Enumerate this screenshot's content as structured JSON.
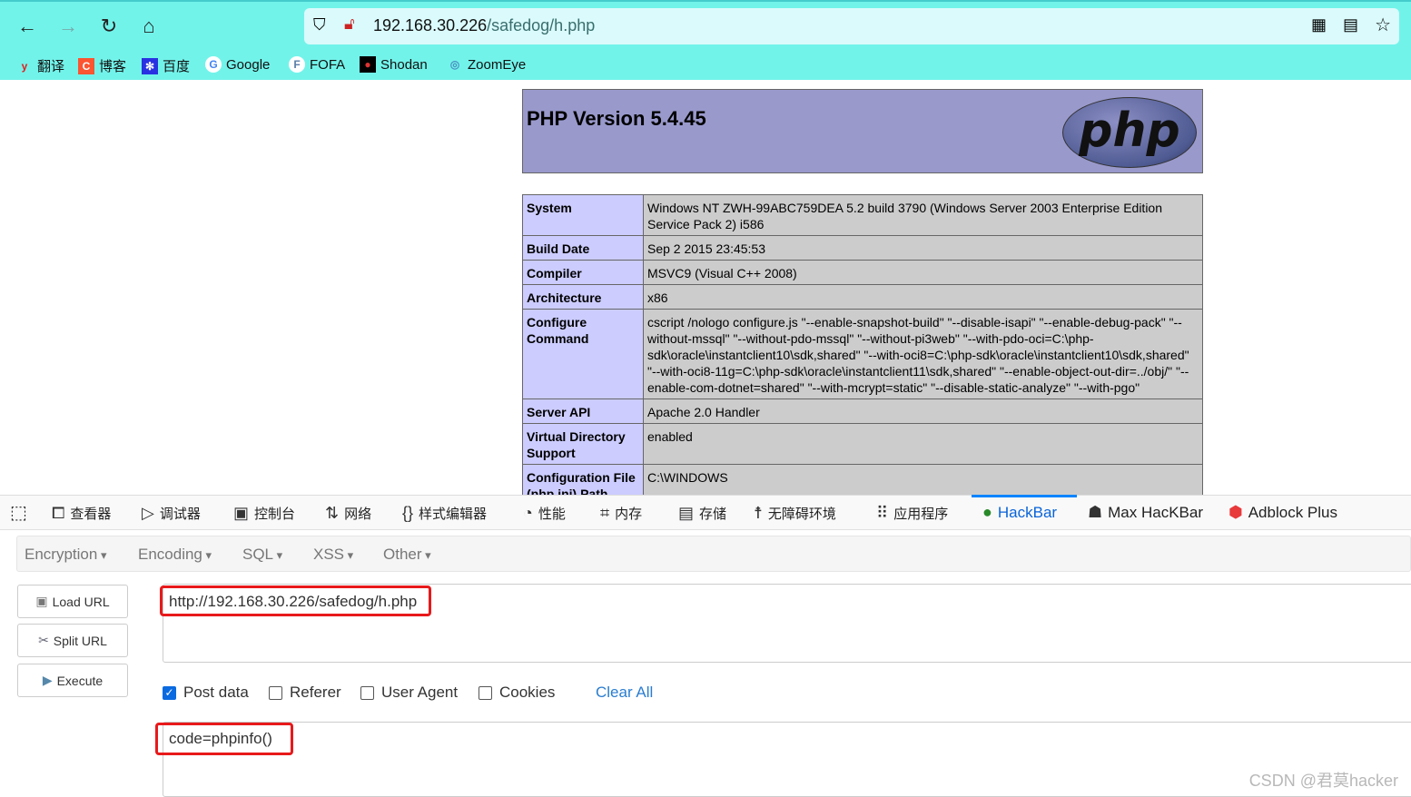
{
  "browser": {
    "url_host": "192.168.30.226",
    "url_path": "/safedog/h.php",
    "bookmarks": [
      {
        "label": "翻译",
        "icon": "youdao-icon",
        "color": "#e02020"
      },
      {
        "label": "博客",
        "icon": "csdn-icon",
        "color": "#fc5531"
      },
      {
        "label": "百度",
        "icon": "baidu-icon",
        "color": "#2932e1"
      },
      {
        "label": "Google",
        "icon": "google-icon",
        "color": "#4285f4"
      },
      {
        "label": "FOFA",
        "icon": "fofa-icon",
        "color": "#5a7fa8"
      },
      {
        "label": "Shodan",
        "icon": "shodan-icon",
        "color": "#000000"
      },
      {
        "label": "ZoomEye",
        "icon": "zoomeye-icon",
        "color": "#4a90c2"
      }
    ]
  },
  "php": {
    "title": "PHP Version 5.4.45",
    "logo": "php",
    "rows": [
      {
        "k": "System",
        "v": "Windows NT ZWH-99ABC759DEA 5.2 build 3790 (Windows Server 2003 Enterprise Edition Service Pack 2) i586"
      },
      {
        "k": "Build Date",
        "v": "Sep 2 2015 23:45:53"
      },
      {
        "k": "Compiler",
        "v": "MSVC9 (Visual C++ 2008)"
      },
      {
        "k": "Architecture",
        "v": "x86"
      },
      {
        "k": "Configure Command",
        "v": "cscript /nologo configure.js \"--enable-snapshot-build\" \"--disable-isapi\" \"--enable-debug-pack\" \"--without-mssql\" \"--without-pdo-mssql\" \"--without-pi3web\" \"--with-pdo-oci=C:\\php-sdk\\oracle\\instantclient10\\sdk,shared\" \"--with-oci8=C:\\php-sdk\\oracle\\instantclient10\\sdk,shared\" \"--with-oci8-11g=C:\\php-sdk\\oracle\\instantclient11\\sdk,shared\" \"--enable-object-out-dir=../obj/\" \"--enable-com-dotnet=shared\" \"--with-mcrypt=static\" \"--disable-static-analyze\" \"--with-pgo\""
      },
      {
        "k": "Server API",
        "v": "Apache 2.0 Handler"
      },
      {
        "k": "Virtual Directory Support",
        "v": "enabled"
      },
      {
        "k": "Configuration File (php.ini) Path",
        "v": "C:\\WINDOWS"
      }
    ]
  },
  "devtools": {
    "tabs": [
      "查看器",
      "调试器",
      "控制台",
      "网络",
      "样式编辑器",
      "性能",
      "内存",
      "存储",
      "无障碍环境",
      "应用程序",
      "HackBar",
      "Max HacKBar",
      "Adblock Plus"
    ],
    "active": "HackBar"
  },
  "hackbar": {
    "menus": [
      "Encryption",
      "Encoding",
      "SQL",
      "XSS",
      "Other"
    ],
    "buttons": [
      "Load URL",
      "Split URL",
      "Execute"
    ],
    "url": "http://192.168.30.226/safedog/h.php",
    "options": [
      {
        "label": "Post data",
        "checked": true
      },
      {
        "label": "Referer",
        "checked": false
      },
      {
        "label": "User Agent",
        "checked": false
      },
      {
        "label": "Cookies",
        "checked": false
      }
    ],
    "clear_all": "Clear All",
    "post_body": "code=phpinfo()"
  },
  "watermark": "CSDN @君莫hacker"
}
